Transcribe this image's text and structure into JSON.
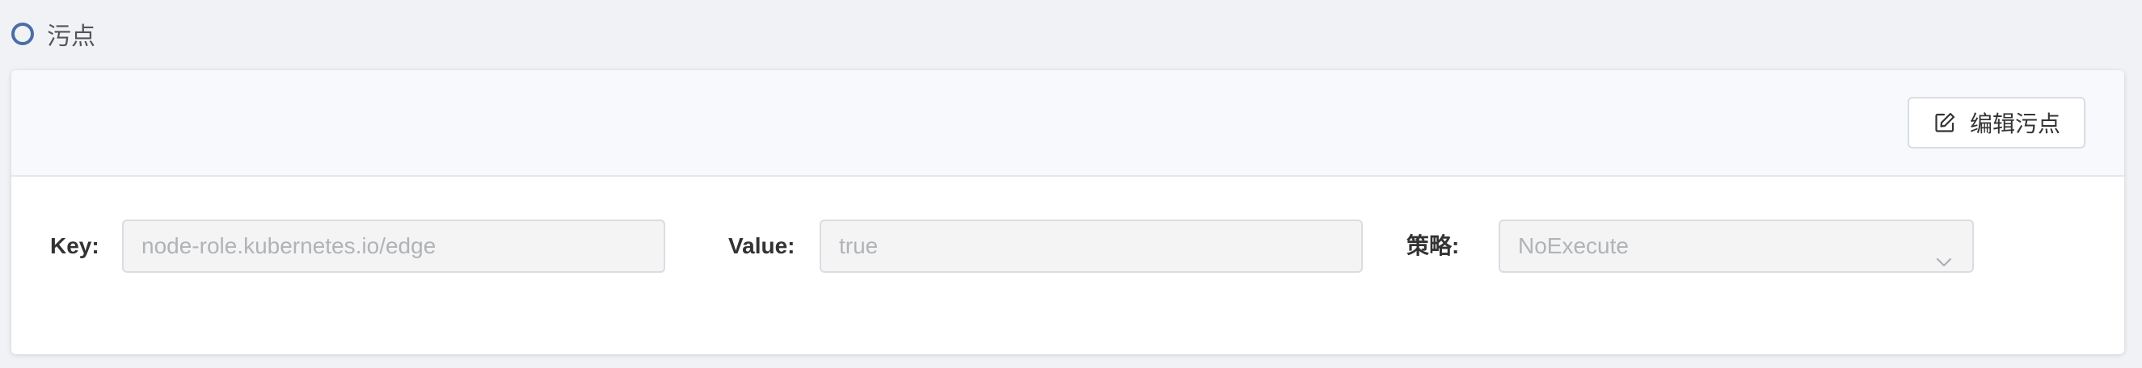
{
  "section": {
    "title": "污点",
    "icon": "circle-icon"
  },
  "toolbar": {
    "edit_label": "编辑污点",
    "edit_icon": "edit-icon"
  },
  "form": {
    "key_label": "Key:",
    "key_value": "node-role.kubernetes.io/edge",
    "value_label": "Value:",
    "value_value": "true",
    "policy_label": "策略:",
    "policy_value": "NoExecute",
    "policy_icon": "chevron-down-icon"
  },
  "colors": {
    "accent": "#4a6fa5",
    "page_bg": "#f0f2f5",
    "toolbar_bg": "#f8f9fc",
    "disabled_input_bg": "#f4f4f5",
    "disabled_text": "#b0b3b8"
  }
}
